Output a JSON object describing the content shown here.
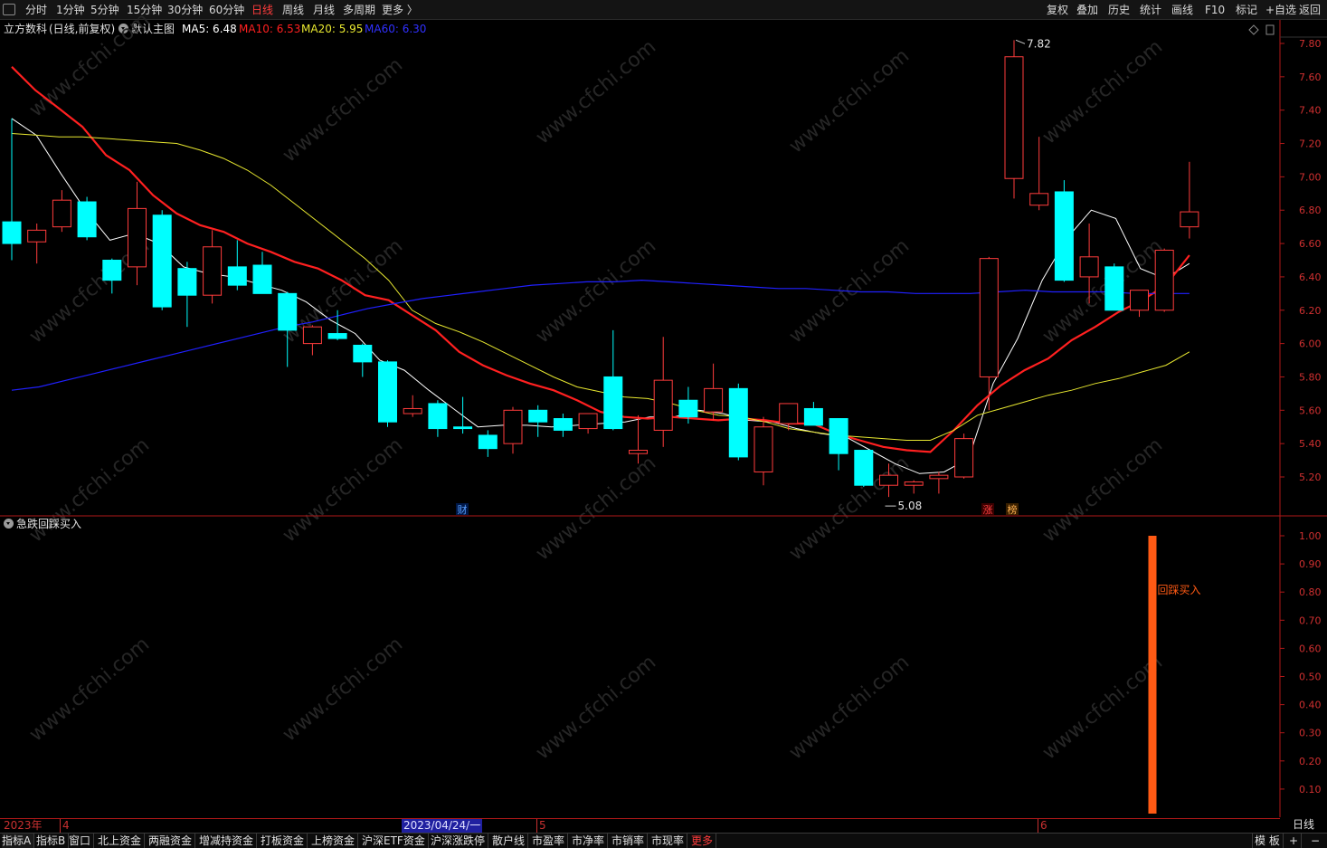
{
  "toolbar": {
    "periods": [
      {
        "label": "分时"
      },
      {
        "label": "1分钟"
      },
      {
        "label": "5分钟"
      },
      {
        "label": "15分钟"
      },
      {
        "label": "30分钟"
      },
      {
        "label": "60分钟"
      },
      {
        "label": "日线",
        "active": true
      },
      {
        "label": "周线"
      },
      {
        "label": "月线"
      },
      {
        "label": "多周期"
      },
      {
        "label": "更多 〉"
      }
    ],
    "right_buttons": [
      "复权",
      "叠加",
      "历史",
      "统计",
      "画线",
      "F10",
      "标记",
      "+自选",
      "返回"
    ]
  },
  "info": {
    "stock": "立方数科",
    "mode": "(日线,前复权)",
    "template": "默认主图",
    "ma5": "MA5: 6.48",
    "ma10": "MA10: 6.53",
    "ma20": "MA20: 5.95",
    "ma60": "MA60: 6.30",
    "colors": {
      "ma5": "#ffffff",
      "ma10": "#ff2020",
      "ma20": "#e8e830",
      "ma60": "#2020ff"
    }
  },
  "price_axis": {
    "ticks": [
      "7.80",
      "7.60",
      "7.40",
      "7.20",
      "7.00",
      "6.80",
      "6.60",
      "6.40",
      "6.20",
      "6.00",
      "5.80",
      "5.60",
      "5.40",
      "5.20"
    ],
    "ylim": [
      5.2,
      7.8
    ]
  },
  "annotations": {
    "high": "7.82",
    "low": "5.08",
    "markers": [
      "财",
      "涨",
      "榜"
    ]
  },
  "indicator": {
    "title": "急跌回踩买入",
    "signal_label": "回踩买入",
    "signal_value": 1.0,
    "ticks": [
      "1.00",
      "0.90",
      "0.80",
      "0.70",
      "0.60",
      "0.50",
      "0.40",
      "0.30",
      "0.20",
      "0.10"
    ],
    "ylim": [
      0,
      1
    ]
  },
  "dates": {
    "year": "2023年",
    "m4": "4",
    "cursor": "2023/04/24/一",
    "m5": "5",
    "m6": "6",
    "period": "日线"
  },
  "tabs": [
    "指标A",
    "指标B",
    "窗口",
    "北上资金",
    "两融资金",
    "增减持资金",
    "打板资金",
    "上榜资金",
    "沪深ETF资金",
    "沪深涨跌停",
    "散户线",
    "市盈率",
    "市净率",
    "市销率",
    "市现率",
    "更多"
  ],
  "bottom_right": [
    "模 板",
    "+",
    "−"
  ],
  "watermark": "www.cfchi.com",
  "colors": {
    "up": "#ff3c3c",
    "down": "#00ffff",
    "grid": "#b01818"
  },
  "chart_data": {
    "type": "candlestick",
    "title": "立方数科",
    "xlabel": "",
    "ylabel": "",
    "ylim": [
      5.2,
      7.8
    ],
    "candles": [
      {
        "o": 6.73,
        "h": 7.35,
        "l": 6.5,
        "c": 6.6
      },
      {
        "o": 6.61,
        "h": 6.72,
        "l": 6.48,
        "c": 6.68
      },
      {
        "o": 6.7,
        "h": 6.92,
        "l": 6.67,
        "c": 6.86
      },
      {
        "o": 6.85,
        "h": 6.88,
        "l": 6.62,
        "c": 6.64
      },
      {
        "o": 6.5,
        "h": 6.51,
        "l": 6.3,
        "c": 6.38
      },
      {
        "o": 6.46,
        "h": 6.97,
        "l": 6.35,
        "c": 6.81
      },
      {
        "o": 6.77,
        "h": 6.8,
        "l": 6.2,
        "c": 6.22
      },
      {
        "o": 6.45,
        "h": 6.49,
        "l": 6.1,
        "c": 6.29
      },
      {
        "o": 6.29,
        "h": 6.68,
        "l": 6.24,
        "c": 6.58
      },
      {
        "o": 6.46,
        "h": 6.62,
        "l": 6.32,
        "c": 6.35
      },
      {
        "o": 6.47,
        "h": 6.55,
        "l": 6.31,
        "c": 6.3
      },
      {
        "o": 6.3,
        "h": 6.31,
        "l": 5.86,
        "c": 6.08
      },
      {
        "o": 6.0,
        "h": 6.11,
        "l": 5.93,
        "c": 6.1
      },
      {
        "o": 6.06,
        "h": 6.2,
        "l": 6.02,
        "c": 6.03
      },
      {
        "o": 5.99,
        "h": 6.0,
        "l": 5.8,
        "c": 5.89
      },
      {
        "o": 5.89,
        "h": 5.9,
        "l": 5.5,
        "c": 5.53
      },
      {
        "o": 5.58,
        "h": 5.69,
        "l": 5.56,
        "c": 5.61
      },
      {
        "o": 5.64,
        "h": 5.66,
        "l": 5.44,
        "c": 5.49
      },
      {
        "o": 5.5,
        "h": 5.68,
        "l": 5.46,
        "c": 5.49
      },
      {
        "o": 5.45,
        "h": 5.48,
        "l": 5.32,
        "c": 5.37
      },
      {
        "o": 5.4,
        "h": 5.62,
        "l": 5.34,
        "c": 5.6
      },
      {
        "o": 5.6,
        "h": 5.63,
        "l": 5.44,
        "c": 5.53
      },
      {
        "o": 5.55,
        "h": 5.58,
        "l": 5.44,
        "c": 5.48
      },
      {
        "o": 5.49,
        "h": 5.57,
        "l": 5.46,
        "c": 5.58
      },
      {
        "o": 5.8,
        "h": 6.08,
        "l": 5.48,
        "c": 5.49
      },
      {
        "o": 5.34,
        "h": 5.57,
        "l": 5.28,
        "c": 5.36
      },
      {
        "o": 5.48,
        "h": 6.04,
        "l": 5.38,
        "c": 5.78
      },
      {
        "o": 5.66,
        "h": 5.74,
        "l": 5.52,
        "c": 5.56
      },
      {
        "o": 5.59,
        "h": 5.88,
        "l": 5.54,
        "c": 5.73
      },
      {
        "o": 5.73,
        "h": 5.76,
        "l": 5.3,
        "c": 5.32
      },
      {
        "o": 5.23,
        "h": 5.56,
        "l": 5.15,
        "c": 5.5
      },
      {
        "o": 5.52,
        "h": 5.64,
        "l": 5.48,
        "c": 5.64
      },
      {
        "o": 5.61,
        "h": 5.65,
        "l": 5.53,
        "c": 5.51
      },
      {
        "o": 5.55,
        "h": 5.55,
        "l": 5.24,
        "c": 5.34
      },
      {
        "o": 5.36,
        "h": 5.36,
        "l": 5.14,
        "c": 5.15
      },
      {
        "o": 5.15,
        "h": 5.28,
        "l": 5.08,
        "c": 5.21
      },
      {
        "o": 5.15,
        "h": 5.18,
        "l": 5.1,
        "c": 5.17
      },
      {
        "o": 5.19,
        "h": 5.23,
        "l": 5.1,
        "c": 5.21
      },
      {
        "o": 5.2,
        "h": 5.46,
        "l": 5.19,
        "c": 5.43
      },
      {
        "o": 5.8,
        "h": 6.52,
        "l": 5.6,
        "c": 6.51
      },
      {
        "o": 6.99,
        "h": 7.82,
        "l": 6.87,
        "c": 7.72
      },
      {
        "o": 6.83,
        "h": 7.24,
        "l": 6.8,
        "c": 6.9
      },
      {
        "o": 6.91,
        "h": 6.98,
        "l": 6.37,
        "c": 6.38
      },
      {
        "o": 6.4,
        "h": 6.72,
        "l": 6.24,
        "c": 6.52
      },
      {
        "o": 6.46,
        "h": 6.48,
        "l": 6.2,
        "c": 6.2
      },
      {
        "o": 6.2,
        "h": 6.32,
        "l": 6.16,
        "c": 6.32
      },
      {
        "o": 6.2,
        "h": 6.57,
        "l": 6.19,
        "c": 6.56
      },
      {
        "o": 6.7,
        "h": 7.09,
        "l": 6.63,
        "c": 6.79
      }
    ],
    "ma": [
      {
        "name": "MA5",
        "values": [
          7.35,
          7.25,
          7.02,
          6.8,
          6.62,
          6.66,
          6.6,
          6.46,
          6.42,
          6.4,
          6.36,
          6.32,
          6.25,
          6.14,
          6.06,
          5.9,
          5.84,
          5.72,
          5.61,
          5.5,
          5.51,
          5.51,
          5.5,
          5.51,
          5.52,
          5.53,
          5.56,
          5.56,
          5.6,
          5.58,
          5.54,
          5.53,
          5.49,
          5.46,
          5.44,
          5.36,
          5.28,
          5.22,
          5.23,
          5.31,
          5.76,
          6.03,
          6.38,
          6.63,
          6.8,
          6.75,
          6.45,
          6.39,
          6.48
        ]
      },
      {
        "name": "MA10",
        "values": [
          7.66,
          7.52,
          7.41,
          7.3,
          7.13,
          7.04,
          6.89,
          6.78,
          6.71,
          6.67,
          6.6,
          6.55,
          6.49,
          6.45,
          6.38,
          6.29,
          6.26,
          6.17,
          6.08,
          5.95,
          5.87,
          5.81,
          5.76,
          5.72,
          5.66,
          5.59,
          5.56,
          5.55,
          5.56,
          5.55,
          5.54,
          5.55,
          5.54,
          5.52,
          5.52,
          5.46,
          5.42,
          5.38,
          5.36,
          5.35,
          5.48,
          5.63,
          5.75,
          5.84,
          5.91,
          6.02,
          6.1,
          6.19,
          6.26,
          6.35,
          6.53
        ]
      },
      {
        "name": "MA20",
        "values": [
          7.26,
          7.25,
          7.24,
          7.24,
          7.23,
          7.22,
          7.21,
          7.2,
          7.16,
          7.11,
          7.04,
          6.95,
          6.84,
          6.73,
          6.62,
          6.51,
          6.38,
          6.2,
          6.12,
          6.07,
          6.01,
          5.94,
          5.87,
          5.8,
          5.74,
          5.71,
          5.68,
          5.67,
          5.64,
          5.6,
          5.57,
          5.56,
          5.53,
          5.49,
          5.47,
          5.45,
          5.44,
          5.43,
          5.42,
          5.42,
          5.48,
          5.57,
          5.61,
          5.65,
          5.69,
          5.72,
          5.76,
          5.79,
          5.83,
          5.87,
          5.95
        ]
      },
      {
        "name": "MA60",
        "values": [
          5.72,
          5.74,
          5.78,
          5.82,
          5.86,
          5.9,
          5.94,
          5.98,
          6.02,
          6.06,
          6.1,
          6.13,
          6.17,
          6.21,
          6.24,
          6.27,
          6.29,
          6.31,
          6.33,
          6.35,
          6.36,
          6.37,
          6.37,
          6.38,
          6.37,
          6.36,
          6.35,
          6.34,
          6.33,
          6.33,
          6.32,
          6.31,
          6.31,
          6.3,
          6.3,
          6.3,
          6.31,
          6.32,
          6.31,
          6.31,
          6.31,
          6.3,
          6.3,
          6.3
        ]
      }
    ],
    "indicator": {
      "name": "回踩买入",
      "signal_index": 45,
      "value": 1.0
    }
  }
}
